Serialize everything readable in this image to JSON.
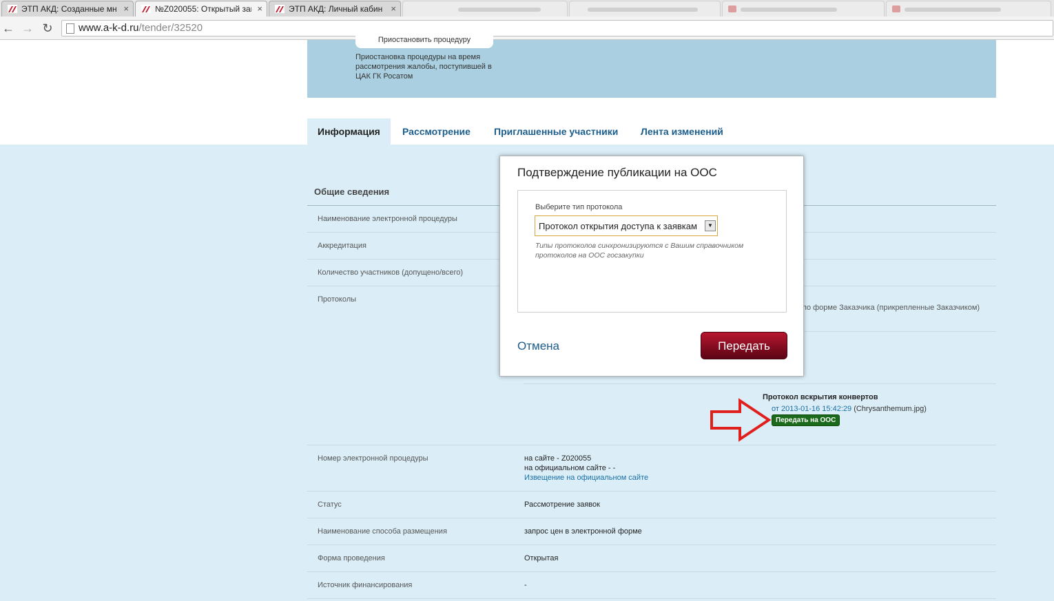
{
  "browser": {
    "tabs": [
      {
        "title": "ЭТП АКД: Созданные мн",
        "active": false
      },
      {
        "title": "№Z020055: Открытый заг",
        "active": true
      },
      {
        "title": "ЭТП АКД: Личный кабин",
        "active": false
      }
    ],
    "close_symbol": "×",
    "url_host": "www.a-k-d.ru",
    "url_path": "/tender/32520",
    "nav_back": "←",
    "nav_forward": "→",
    "nav_reload": "↻"
  },
  "banner": {
    "suspend_button": "Приостановить процедуру",
    "suspend_note": "Приостановка процедуры на время рассмотрения жалобы, поступившей в ЦАК ГК Росатом"
  },
  "tabs": {
    "info": "Информация",
    "review": "Рассмотрение",
    "invited": "Приглашенные участники",
    "changes": "Лента изменений"
  },
  "general": {
    "title": "Общие сведения",
    "rows": {
      "name_label": "Наименование электронной процедуры",
      "accreditation_label": "Аккредитация",
      "participants_label": "Количество участников (допущено/всего)",
      "protocols_label": "Протоколы",
      "protocols_customer_note": "по форме Заказчика (прикрепленные Заказчиком)",
      "number_label": "Номер электронной процедуры",
      "number_value_site": "на сайте - Z020055",
      "number_value_official": "на официальном сайте - -",
      "number_value_link": "Извещение на официальном сайте",
      "status_label": "Статус",
      "status_value": "Рассмотрение заявок",
      "method_label": "Наименование способа размещения",
      "method_value": "запрос цен в электронной форме",
      "form_label": "Форма проведения",
      "form_value": "Открытая",
      "funding_label": "Источник финансирования",
      "funding_value": "-"
    }
  },
  "protocol": {
    "title": "Протокол вскрытия конвертов",
    "date_link": "от 2013-01-16 15:42:29",
    "file": "(Chrysanthemum.jpg)",
    "send_button": "Передать на ООС"
  },
  "modal": {
    "title": "Подтверждение публикации на ООС",
    "field_label": "Выберите тип протокола",
    "selected_value": "Протокол открытия доступа к заявкам",
    "hint": "Типы протоколов синхронизируются с Вашим справочником протоколов на ООС госзакупки",
    "cancel": "Отмена",
    "submit": "Передать"
  },
  "colors": {
    "accent": "#1a5d8c",
    "submit": "#8f0f24",
    "send_green": "#1b6a1b",
    "arrow": "#e0201c"
  }
}
